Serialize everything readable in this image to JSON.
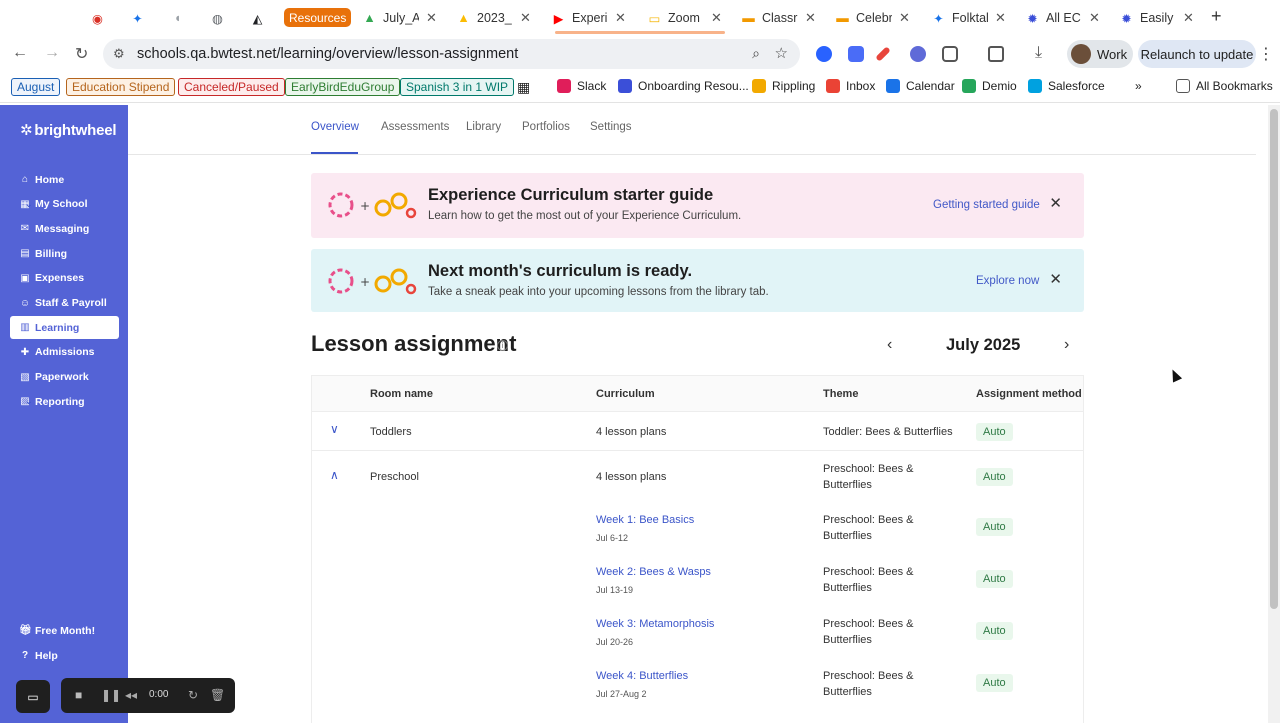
{
  "tabs": [
    {
      "title": "",
      "icon": "record-icon",
      "color": "#d93025"
    },
    {
      "title": "",
      "icon": "star-icon",
      "color": "#1a73e8"
    },
    {
      "title": "",
      "icon": "speaker-icon",
      "color": "#9aa0a6"
    },
    {
      "title": "",
      "icon": "globe-icon",
      "color": "#5f6368"
    },
    {
      "title": "",
      "icon": "triangle-app-icon",
      "color": "#202124"
    },
    {
      "title": "July_A",
      "icon": "drive-icon",
      "color": "#34a853"
    },
    {
      "title": "2023_",
      "icon": "drive-icon",
      "color": "#fbbc04"
    },
    {
      "title": "Experi",
      "icon": "youtube-icon",
      "color": "#ff0000"
    },
    {
      "title": "Zoom",
      "icon": "slides-icon",
      "color": "#f4b400"
    },
    {
      "title": "Classr",
      "icon": "bar-icon",
      "color": "#f29900"
    },
    {
      "title": "Celebr",
      "icon": "bar-icon",
      "color": "#f29900"
    },
    {
      "title": "Folktal",
      "icon": "star-icon",
      "color": "#1a73e8"
    },
    {
      "title": "All EC",
      "icon": "gear-icon",
      "color": "#3b4fd8"
    },
    {
      "title": "Easily",
      "icon": "gear-icon",
      "color": "#3b4fd8"
    }
  ],
  "resources_label": "Resources",
  "url": "schools.qa.bwtest.net/learning/overview/lesson-assignment",
  "profile_label": "Work",
  "relaunch_label": "Relaunch to update",
  "bookmark_tags": [
    {
      "label": "August",
      "color": "#1a5fb4",
      "bg": "#eef3fb"
    },
    {
      "label": "Education Stipend",
      "color": "#b5651d",
      "bg": "#fdf1e4"
    },
    {
      "label": "Canceled/Paused",
      "color": "#c62828",
      "bg": "#fdecec"
    },
    {
      "label": "EarlyBirdEduGroup",
      "color": "#2e7d32",
      "bg": "#eaf6ec"
    },
    {
      "label": "Spanish 3 in 1 WIP",
      "color": "#00796b",
      "bg": "#e6f5f3"
    }
  ],
  "bookmarks": [
    {
      "label": "Slack",
      "color": "#e01e5a"
    },
    {
      "label": "Onboarding Resou...",
      "color": "#3b4fd8"
    },
    {
      "label": "Rippling",
      "color": "#f2a900"
    },
    {
      "label": "Inbox",
      "color": "#ea4335"
    },
    {
      "label": "Calendar",
      "color": "#1a73e8"
    },
    {
      "label": "Demio",
      "color": "#26a65b"
    },
    {
      "label": "Salesforce",
      "color": "#00a1e0"
    }
  ],
  "all_bookmarks_label": "All Bookmarks",
  "sidebar": {
    "logo": "brightwheel",
    "items": [
      {
        "label": "Home",
        "icon": "home-icon",
        "chevron": false
      },
      {
        "label": "My School",
        "icon": "school-icon",
        "chevron": true
      },
      {
        "label": "Messaging",
        "icon": "chat-icon",
        "chevron": false
      },
      {
        "label": "Billing",
        "icon": "billing-icon",
        "chevron": false
      },
      {
        "label": "Expenses",
        "icon": "expenses-icon",
        "chevron": false
      },
      {
        "label": "Staff & Payroll",
        "icon": "staff-icon",
        "chevron": false
      },
      {
        "label": "Learning",
        "icon": "learning-icon",
        "chevron": false,
        "active": true
      },
      {
        "label": "Admissions",
        "icon": "admissions-icon",
        "chevron": false
      },
      {
        "label": "Paperwork",
        "icon": "paperwork-icon",
        "chevron": false
      },
      {
        "label": "Reporting",
        "icon": "reporting-icon",
        "chevron": true
      }
    ],
    "free_month": "Free Month!",
    "help": "Help"
  },
  "subnav": [
    "Overview",
    "Assessments",
    "Library",
    "Portfolios",
    "Settings"
  ],
  "banners": [
    {
      "title": "Experience Curriculum starter guide",
      "subtitle": "Learn how to get the most out of your Experience Curriculum.",
      "link": "Getting started guide"
    },
    {
      "title": "Next month's curriculum is ready.",
      "subtitle": "Take a sneak peak into your upcoming lessons from the library tab.",
      "link": "Explore now"
    }
  ],
  "section_title": "Lesson assignment",
  "month_label": "July 2025",
  "table": {
    "headers": [
      "Room name",
      "Curriculum",
      "Theme",
      "Assignment method"
    ],
    "rooms": [
      {
        "name": "Toddlers",
        "curriculum": "4 lesson plans",
        "theme": "Toddler: Bees & Butterflies",
        "method": "Auto"
      },
      {
        "name": "Preschool",
        "curriculum": "4 lesson plans",
        "theme": "Preschool: Bees & Butterflies",
        "method": "Auto"
      }
    ],
    "weeks": [
      {
        "title": "Week 1: Bee Basics",
        "dates": "Jul 6-12",
        "theme": "Preschool: Bees & Butterflies",
        "method": "Auto"
      },
      {
        "title": "Week 2: Bees & Wasps",
        "dates": "Jul 13-19",
        "theme": "Preschool: Bees & Butterflies",
        "method": "Auto"
      },
      {
        "title": "Week 3: Metamorphosis",
        "dates": "Jul 20-26",
        "theme": "Preschool: Bees & Butterflies",
        "method": "Auto"
      },
      {
        "title": "Week 4: Butterflies",
        "dates": "Jul 27-Aug 2",
        "theme": "Preschool: Bees & Butterflies",
        "method": "Auto"
      }
    ]
  },
  "recorder": {
    "time": "0:00"
  }
}
